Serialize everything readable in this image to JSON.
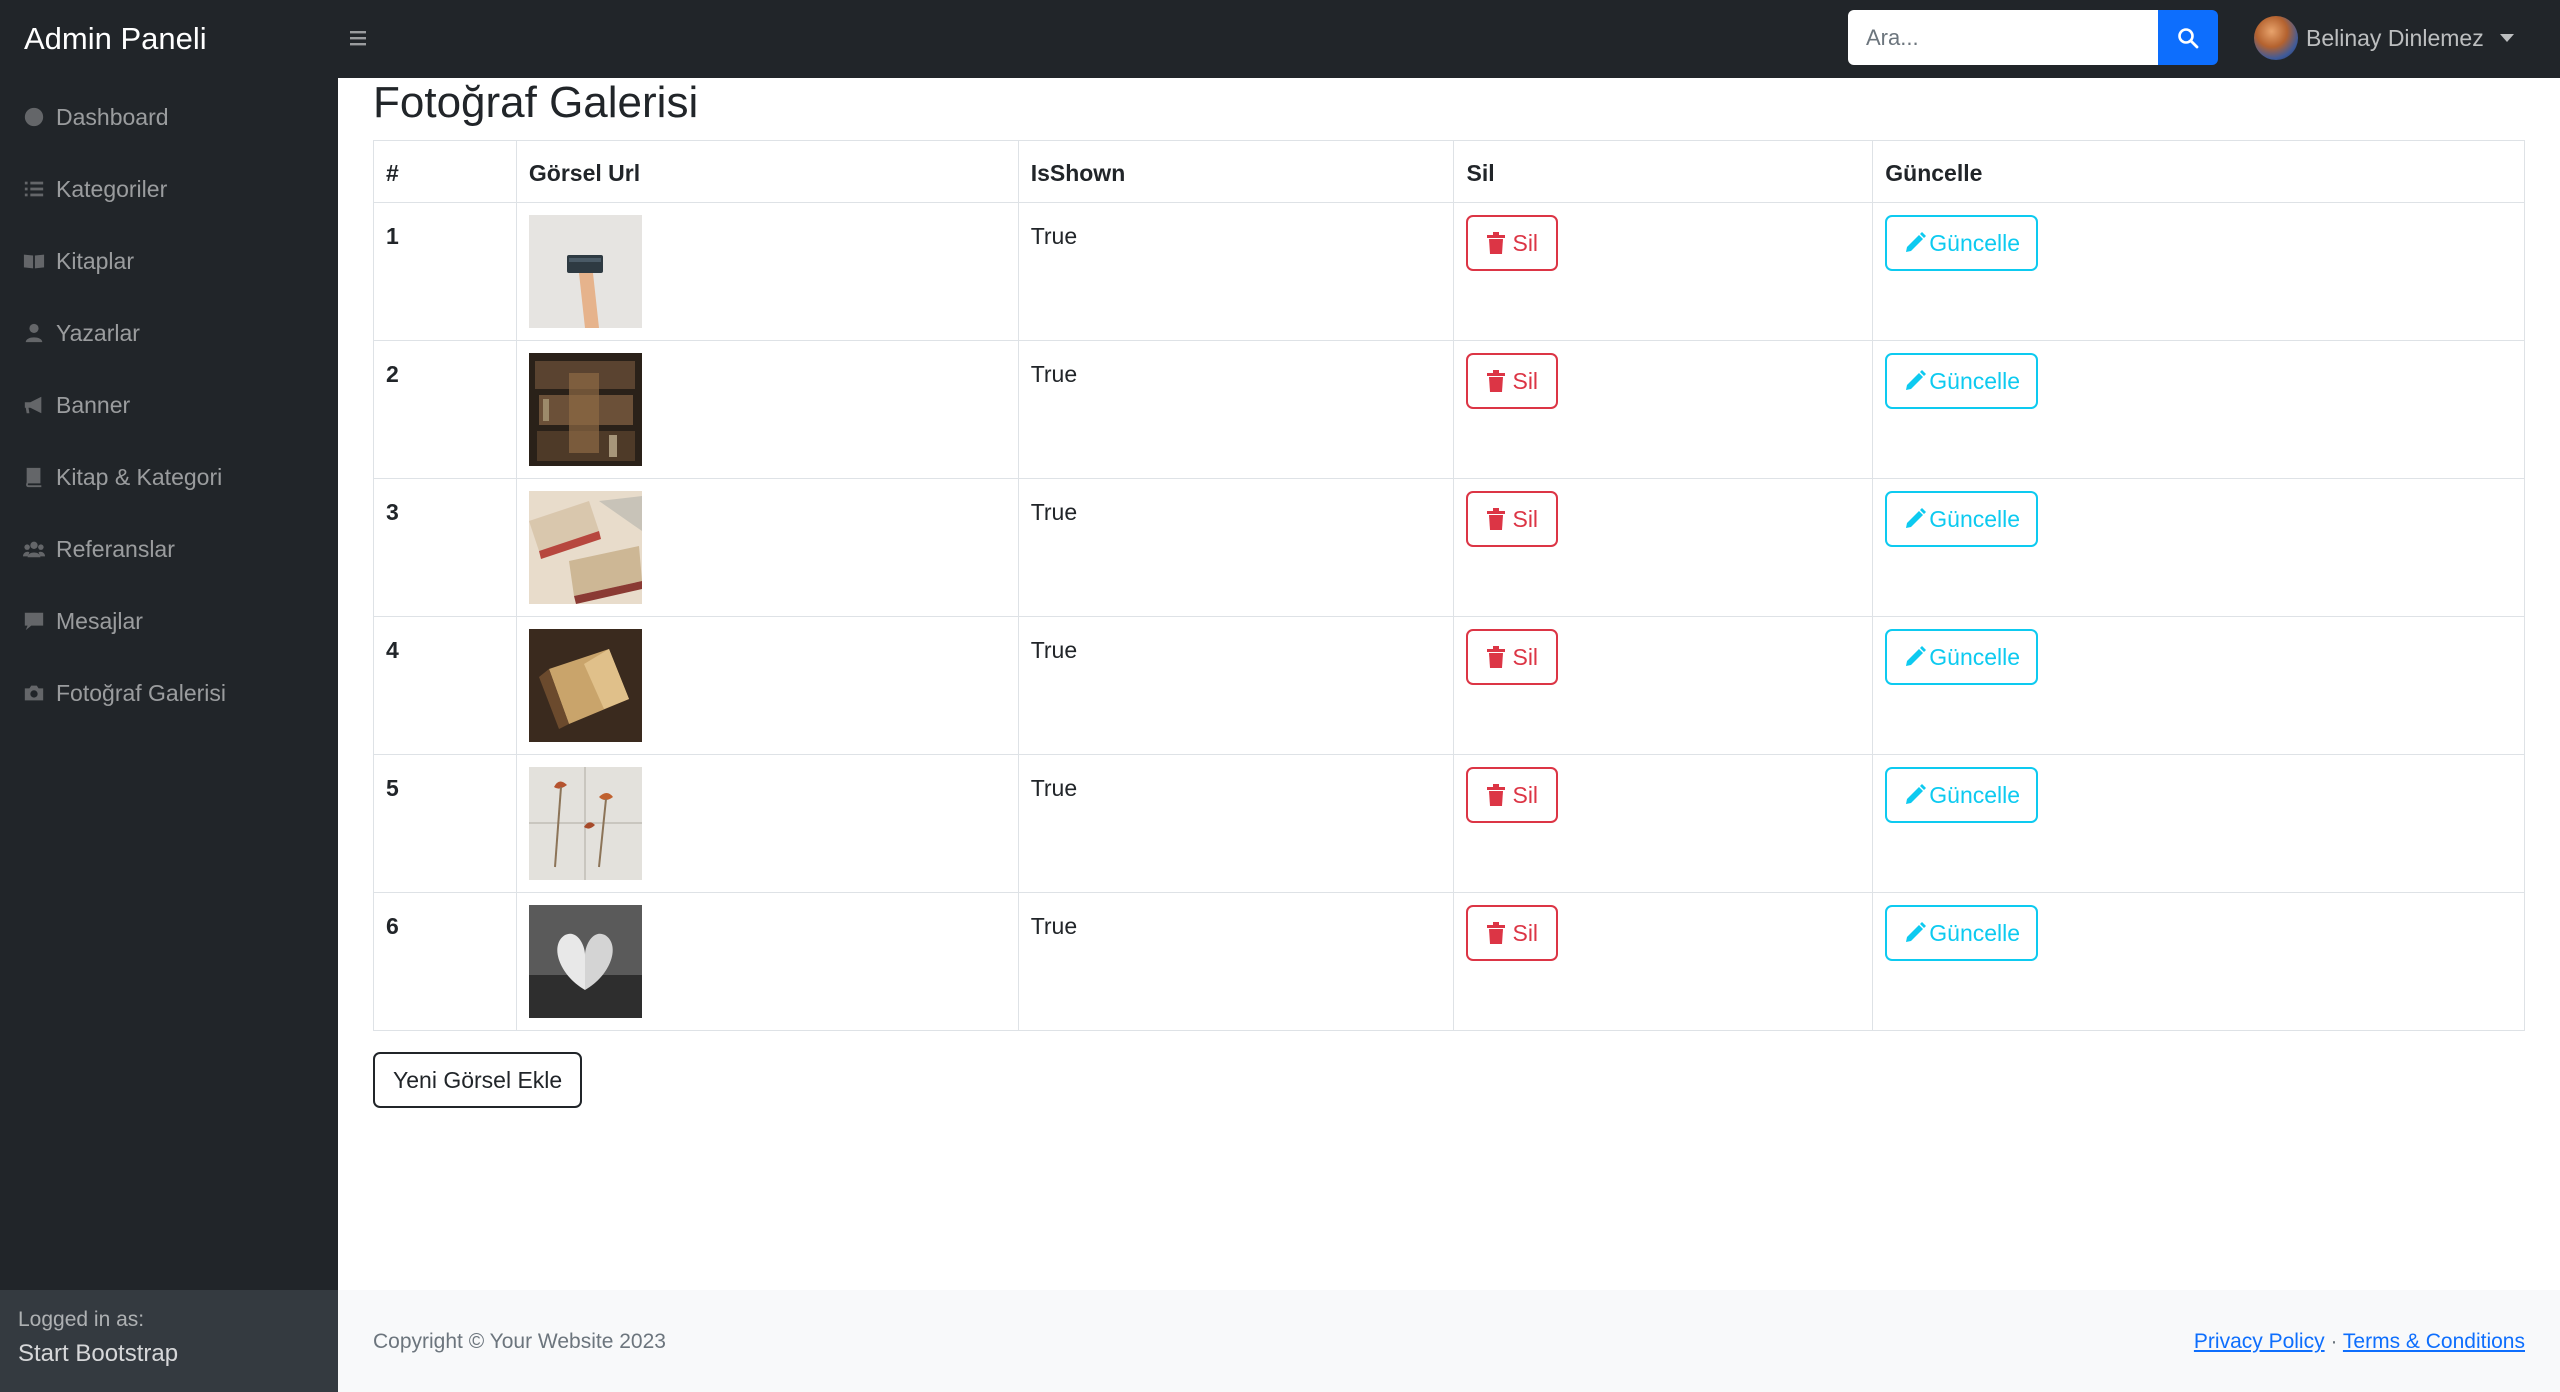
{
  "nav": {
    "brand": "Admin Paneli",
    "search_placeholder": "Ara...",
    "user_name": "Belinay Dinlemez"
  },
  "sidebar": {
    "items": [
      {
        "label": "Dashboard",
        "icon": "dashboard-icon"
      },
      {
        "label": "Kategoriler",
        "icon": "list-icon"
      },
      {
        "label": "Kitaplar",
        "icon": "book-open-icon"
      },
      {
        "label": "Yazarlar",
        "icon": "user-icon"
      },
      {
        "label": "Banner",
        "icon": "bullhorn-icon"
      },
      {
        "label": "Kitap & Kategori",
        "icon": "book-icon"
      },
      {
        "label": "Referanslar",
        "icon": "users-icon"
      },
      {
        "label": "Mesajlar",
        "icon": "comment-icon"
      },
      {
        "label": "Fotoğraf Galerisi",
        "icon": "camera-icon"
      }
    ],
    "footer_label": "Logged in as:",
    "footer_name": "Start Bootstrap"
  },
  "page": {
    "title": "Fotoğraf Galerisi",
    "columns": [
      "#",
      "Görsel Url",
      "IsShown",
      "Sil",
      "Güncelle"
    ],
    "rows": [
      {
        "id": "1",
        "shown": "True",
        "delete_label": "Sil",
        "update_label": "Güncelle"
      },
      {
        "id": "2",
        "shown": "True",
        "delete_label": "Sil",
        "update_label": "Güncelle"
      },
      {
        "id": "3",
        "shown": "True",
        "delete_label": "Sil",
        "update_label": "Güncelle"
      },
      {
        "id": "4",
        "shown": "True",
        "delete_label": "Sil",
        "update_label": "Güncelle"
      },
      {
        "id": "5",
        "shown": "True",
        "delete_label": "Sil",
        "update_label": "Güncelle"
      },
      {
        "id": "6",
        "shown": "True",
        "delete_label": "Sil",
        "update_label": "Güncelle"
      }
    ],
    "add_button": "Yeni Görsel Ekle"
  },
  "footer": {
    "copyright": "Copyright © Your Website 2023",
    "privacy": "Privacy Policy",
    "separator": "·",
    "terms": "Terms & Conditions"
  },
  "colors": {
    "dark": "#212529",
    "primary": "#0d6efd",
    "danger": "#dc3545",
    "info": "#0dcaf0"
  }
}
